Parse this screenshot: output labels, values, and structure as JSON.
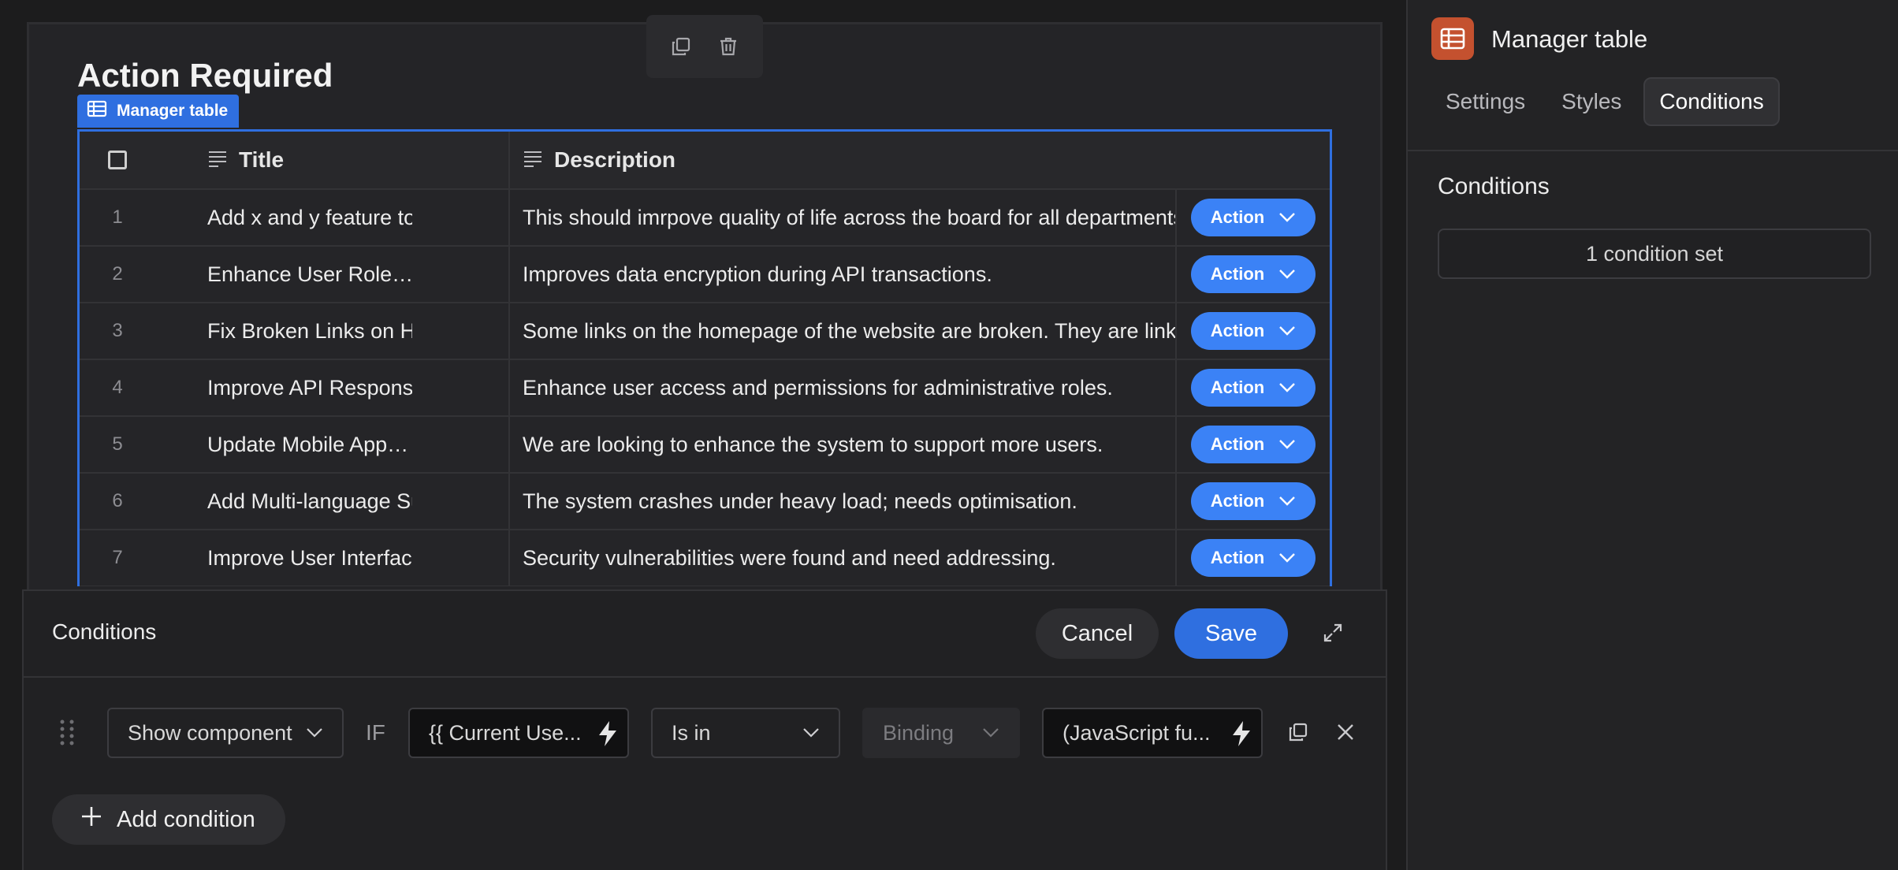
{
  "canvas": {
    "heading": "Action Required",
    "toolbar": {
      "icons": [
        "duplicate-icon",
        "trash-icon"
      ]
    },
    "component_tag": {
      "label": "Manager table",
      "icon": "table-icon"
    },
    "table": {
      "columns": {
        "title": "Title",
        "description": "Description"
      },
      "rows": [
        {
          "idx": "1",
          "title": "Add x and y feature to the…",
          "description": "This should imrpove quality of life across the board for all departments",
          "action": "Action"
        },
        {
          "idx": "2",
          "title": "Enhance User Role…",
          "description": "Improves data encryption during API transactions.",
          "action": "Action"
        },
        {
          "idx": "3",
          "title": "Fix Broken Links on Homepage",
          "description": "Some links on the homepage of the website are broken. They are linking",
          "action": "Action"
        },
        {
          "idx": "4",
          "title": "Improve API Response Times",
          "description": "Enhance user access and permissions for administrative roles.",
          "action": "Action"
        },
        {
          "idx": "5",
          "title": "Update Mobile App…",
          "description": "We are looking to enhance the system to support more users.",
          "action": "Action"
        },
        {
          "idx": "6",
          "title": "Add Multi-language Support",
          "description": "The system crashes under heavy load; needs optimisation.",
          "action": "Action"
        },
        {
          "idx": "7",
          "title": "Improve User Interface…",
          "description": "Security vulnerabilities were found and need addressing.",
          "action": "Action"
        }
      ]
    }
  },
  "conditions_panel": {
    "title": "Conditions",
    "cancel_label": "Cancel",
    "save_label": "Save",
    "row": {
      "action": "Show component",
      "if_label": "IF",
      "left_operand": "{{ Current Use...",
      "operator": "Is in",
      "binding": "Binding",
      "right_operand": "(JavaScript fu..."
    },
    "add_condition_label": "Add condition"
  },
  "inspector": {
    "title": "Manager table",
    "tabs": [
      "Settings",
      "Styles",
      "Conditions"
    ],
    "active_tab": "Conditions",
    "section_title": "Conditions",
    "condition_summary": "1 condition set"
  },
  "colors": {
    "accent": "#2f6fe0",
    "action_button": "#3b82f6",
    "component_icon_bg": "#c4512f",
    "background": "#1c1c1d"
  }
}
